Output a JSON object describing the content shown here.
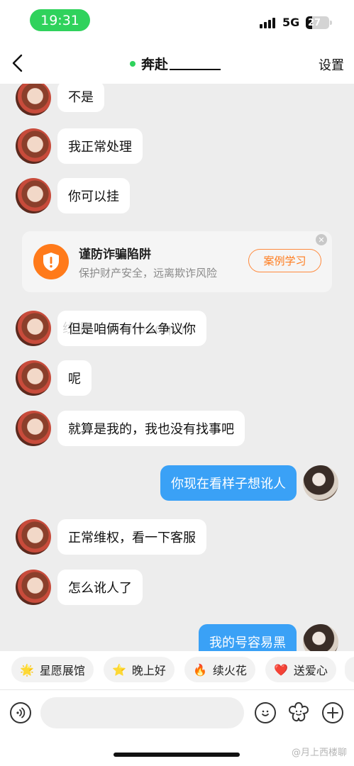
{
  "status_bar": {
    "time": "19:31",
    "network": "5G",
    "battery": "27",
    "battery_level": 0.27
  },
  "header": {
    "title": "奔赴",
    "settings": "设置"
  },
  "messages": [
    {
      "side": "left",
      "text": "不是"
    },
    {
      "side": "left",
      "text": "我正常处理"
    },
    {
      "side": "left",
      "text": "你可以挂"
    },
    {
      "side": "left",
      "text": "但是咱俩有什么争议你"
    },
    {
      "side": "left",
      "text": "呢"
    },
    {
      "side": "left",
      "text": "就算是我的，我也没有找事吧"
    },
    {
      "side": "right",
      "text": "你现在看样子想讹人"
    },
    {
      "side": "left",
      "text": "正常维权，看一下客服"
    },
    {
      "side": "left",
      "text": "怎么讹人了"
    },
    {
      "side": "right",
      "text": "我的号容易黑"
    }
  ],
  "fraud_warning": {
    "title": "谨防诈骗陷阱",
    "subtitle": "保护财产安全，远离欺诈风险",
    "button": "案例学习",
    "icon": "shield-alert-icon",
    "color": "#ff7a1a"
  },
  "watermark": "线报… xianbaoqun",
  "quick_replies": [
    {
      "icon": "star-face-icon",
      "glyph": "🌟",
      "label": "星愿展馆"
    },
    {
      "icon": "sleepy-star-icon",
      "glyph": "⭐",
      "label": "晚上好"
    },
    {
      "icon": "fire-icon",
      "glyph": "🔥",
      "label": "续火花"
    },
    {
      "icon": "heart-icon",
      "glyph": "❤️",
      "label": "送爱心"
    }
  ],
  "input_bar": {
    "placeholder": ""
  },
  "credit": "@月上西楼聊",
  "colors": {
    "online": "#2fd25c",
    "outgoing_bubble": "#3aa1f6",
    "incoming_bubble": "#ffffff",
    "accent": "#ff7a1a"
  }
}
